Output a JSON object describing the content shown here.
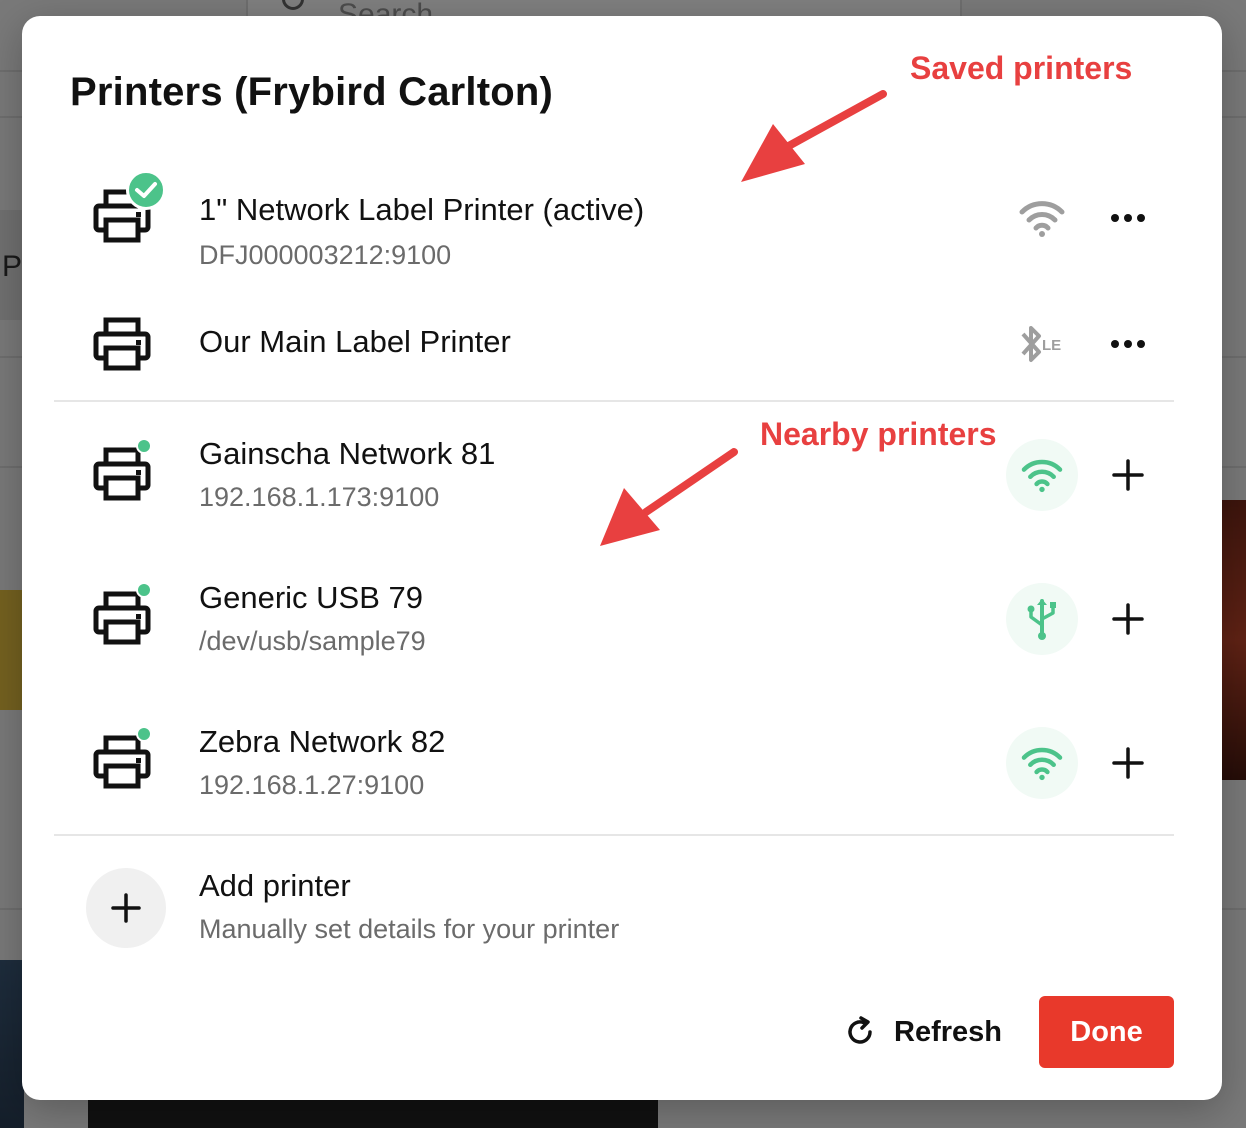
{
  "background": {
    "search_placeholder": "Search",
    "side_letter": "P"
  },
  "modal": {
    "title": "Printers (Frybird Carlton)",
    "saved_printers": [
      {
        "name": "1\" Network Label Printer (active)",
        "address": "DFJ000003212:9100",
        "connection_icon": "wifi-icon",
        "connection_color": "#9e9e9e",
        "status": "active",
        "action_icon": "more-icon"
      },
      {
        "name": "Our Main Label Printer",
        "address": "",
        "connection_icon": "bluetooth-le-icon",
        "connection_color": "#9e9e9e",
        "action_icon": "more-icon"
      }
    ],
    "nearby_printers": [
      {
        "name": "Gainscha Network 81",
        "address": "192.168.1.173:9100",
        "connection_icon": "wifi-icon",
        "connection_color": "#4cc38a",
        "action_icon": "plus-icon"
      },
      {
        "name": "Generic USB 79",
        "address": "/dev/usb/sample79",
        "connection_icon": "usb-icon",
        "connection_color": "#4cc38a",
        "action_icon": "plus-icon"
      },
      {
        "name": "Zebra Network 82",
        "address": "192.168.1.27:9100",
        "connection_icon": "wifi-icon",
        "connection_color": "#4cc38a",
        "action_icon": "plus-icon"
      }
    ],
    "add_printer": {
      "title": "Add printer",
      "subtitle": "Manually set details for your printer"
    },
    "footer": {
      "refresh_label": "Refresh",
      "done_label": "Done"
    }
  },
  "annotations": {
    "saved_label": "Saved printers",
    "nearby_label": "Nearby printers",
    "color": "#e84040"
  },
  "colors": {
    "accent": "#e8392b",
    "status_green": "#4cc38a"
  }
}
